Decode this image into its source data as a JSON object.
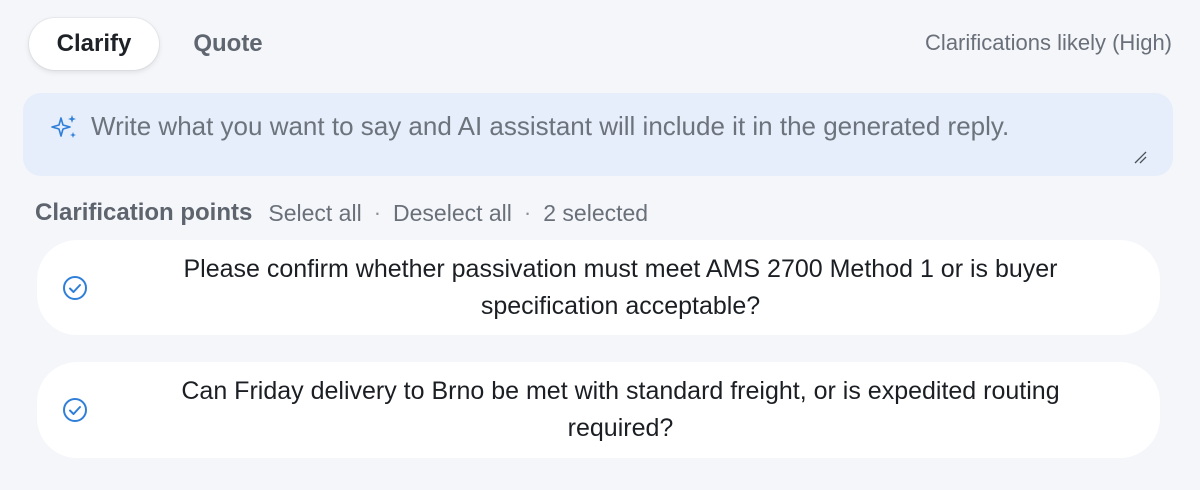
{
  "tabs": [
    {
      "label": "Clarify",
      "active": true
    },
    {
      "label": "Quote",
      "active": false
    }
  ],
  "likelihood": "Clarifications likely (High)",
  "prompt": {
    "placeholder": "Write what you want to say and AI assistant will include it in the generated reply.",
    "icon": "sparkle-icon"
  },
  "clarification": {
    "title": "Clarification points",
    "select_all": "Select all",
    "separator": "·",
    "deselect_all": "Deselect all",
    "selected_count": "2 selected",
    "items": [
      {
        "text": "Please confirm whether passivation must meet AMS 2700 Method 1 or is buyer specification acceptable?",
        "checked": true
      },
      {
        "text": "Can Friday delivery to Brno be met with standard freight, or is expedited routing required?",
        "checked": true
      }
    ]
  },
  "colors": {
    "accent": "#2f7fd8",
    "prompt_bg": "#e6eefb",
    "page_bg": "#f4f6fa"
  }
}
